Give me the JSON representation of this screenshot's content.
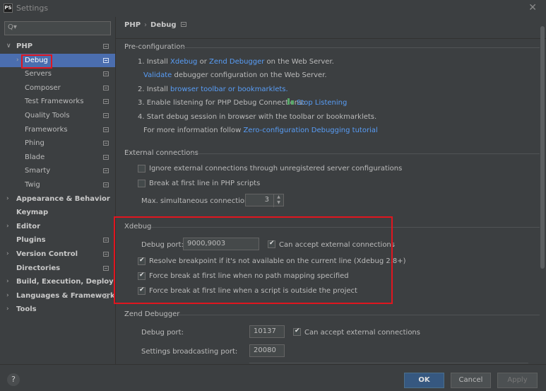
{
  "window": {
    "title": "Settings",
    "app_icon": "PS"
  },
  "search": {
    "placeholder": ""
  },
  "sidebar": {
    "items": [
      {
        "label": "PHP",
        "arrow": "∨",
        "bold": true
      },
      {
        "label": "Debug",
        "arrow": "›",
        "selected": true
      },
      {
        "label": "Servers"
      },
      {
        "label": "Composer"
      },
      {
        "label": "Test Frameworks"
      },
      {
        "label": "Quality Tools"
      },
      {
        "label": "Frameworks"
      },
      {
        "label": "Phing"
      },
      {
        "label": "Blade"
      },
      {
        "label": "Smarty"
      },
      {
        "label": "Twig"
      },
      {
        "label": "Appearance & Behavior",
        "arrow": "›",
        "bold": true
      },
      {
        "label": "Keymap",
        "bold": true
      },
      {
        "label": "Editor",
        "arrow": "›",
        "bold": true
      },
      {
        "label": "Plugins",
        "bold": true
      },
      {
        "label": "Version Control",
        "arrow": "›",
        "bold": true
      },
      {
        "label": "Directories",
        "bold": true
      },
      {
        "label": "Build, Execution, Deployment",
        "arrow": "›",
        "bold": true
      },
      {
        "label": "Languages & Frameworks",
        "arrow": "›",
        "bold": true
      },
      {
        "label": "Tools",
        "arrow": "›",
        "bold": true
      }
    ]
  },
  "breadcrumb": {
    "root": "PHP",
    "separator": "›",
    "page": "Debug"
  },
  "preconfig": {
    "title": "Pre-configuration",
    "step1_prefix": "1. Install ",
    "xdebug_link": "Xdebug",
    "or": " or ",
    "zend_link": "Zend Debugger",
    "step1_suffix": " on the Web Server.",
    "validate_link": "Validate",
    "validate_suffix": " debugger configuration on the Web Server.",
    "step2_prefix": "2. Install ",
    "toolbar_link": "browser toolbar or bookmarklets.",
    "step3_prefix": "3. Enable listening for PHP Debug Connections:",
    "stop_listening_link": "Stop Listening",
    "step4": "4. Start debug session in browser with the toolbar or bookmarklets.",
    "more_info_prefix": "For more information follow ",
    "zero_config_link": "Zero-configuration Debugging tutorial"
  },
  "external": {
    "title": "External connections",
    "ignore_label": "Ignore external connections through unregistered server configurations",
    "ignore_checked": false,
    "break_first_label": "Break at first line in PHP scripts",
    "break_first_checked": false,
    "max_conn_label": "Max. simultaneous connections:",
    "max_conn_value": "3"
  },
  "xdebug": {
    "title": "Xdebug",
    "port_label": "Debug port:",
    "port_value": "9000,9003",
    "accept_label": "Can accept external connections",
    "accept_checked": true,
    "resolve_label": "Resolve breakpoint if it's not available on the current line (Xdebug 2.8+)",
    "resolve_checked": true,
    "force_nopath_label": "Force break at first line when no path mapping specified",
    "force_nopath_checked": true,
    "force_outside_label": "Force break at first line when a script is outside the project",
    "force_outside_checked": true
  },
  "zend": {
    "title": "Zend Debugger",
    "port_label": "Debug port:",
    "port_value": "10137",
    "accept_label": "Can accept external connections",
    "accept_checked": true,
    "broadcast_label": "Settings broadcasting port:",
    "broadcast_value": "20080"
  },
  "footer": {
    "help": "?",
    "ok": "OK",
    "cancel": "Cancel",
    "apply": "Apply"
  },
  "colors": {
    "link": "#589df6",
    "selection": "#4b6eaf",
    "highlight": "#e0161f",
    "ok_button": "#365880"
  }
}
